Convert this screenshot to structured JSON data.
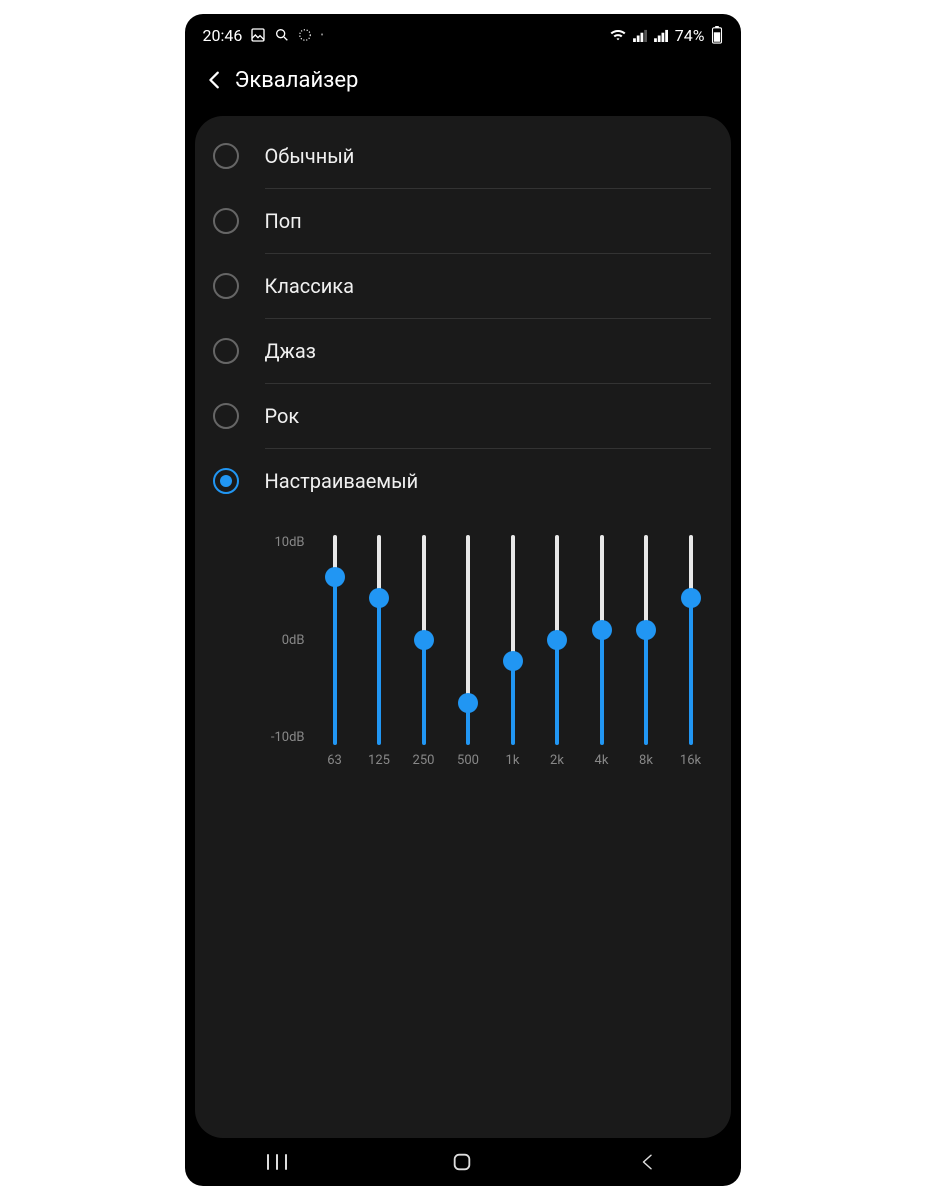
{
  "status": {
    "time": "20:46",
    "battery_text": "74%"
  },
  "header": {
    "title": "Эквалайзер"
  },
  "presets": [
    {
      "label": "Обычный",
      "selected": false
    },
    {
      "label": "Поп",
      "selected": false
    },
    {
      "label": "Классика",
      "selected": false
    },
    {
      "label": "Джаз",
      "selected": false
    },
    {
      "label": "Рок",
      "selected": false
    },
    {
      "label": "Настраиваемый",
      "selected": true
    }
  ],
  "chart_data": {
    "type": "equalizer",
    "title": "",
    "ylabel": "",
    "ylim": [
      -10,
      10
    ],
    "ytick_labels": [
      "10dB",
      "0dB",
      "-10dB"
    ],
    "bands": [
      "63",
      "125",
      "250",
      "500",
      "1k",
      "2k",
      "4k",
      "8k",
      "16k"
    ],
    "values": [
      6,
      4,
      0,
      -6,
      -2,
      0,
      1,
      1,
      4
    ],
    "accent": "#2196f3"
  }
}
